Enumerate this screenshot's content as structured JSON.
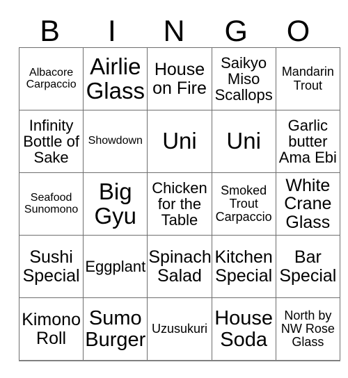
{
  "card": {
    "headers": [
      "B",
      "I",
      "N",
      "G",
      "O"
    ],
    "rows": [
      [
        {
          "text": "Albacore Carpaccio",
          "size": "xs"
        },
        {
          "text": "Airlie Glass",
          "size": "xxl"
        },
        {
          "text": "House on Fire",
          "size": "l"
        },
        {
          "text": "Saikyo Miso Scallops",
          "size": "m"
        },
        {
          "text": "Mandarin Trout",
          "size": "s"
        }
      ],
      [
        {
          "text": "Infinity Bottle of Sake",
          "size": "m"
        },
        {
          "text": "Showdown",
          "size": "xs"
        },
        {
          "text": "Uni",
          "size": "xxl"
        },
        {
          "text": "Uni",
          "size": "xxl"
        },
        {
          "text": "Garlic butter Ama Ebi",
          "size": "m"
        }
      ],
      [
        {
          "text": "Seafood Sunomono",
          "size": "xs"
        },
        {
          "text": "Big Gyu",
          "size": "xxl"
        },
        {
          "text": "Chicken for the Table",
          "size": "m"
        },
        {
          "text": "Smoked Trout Carpaccio",
          "size": "s"
        },
        {
          "text": "White Crane Glass",
          "size": "l"
        }
      ],
      [
        {
          "text": "Sushi Special",
          "size": "l"
        },
        {
          "text": "Eggplant",
          "size": "m"
        },
        {
          "text": "Spinach Salad",
          "size": "l"
        },
        {
          "text": "Kitchen Special",
          "size": "l"
        },
        {
          "text": "Bar Special",
          "size": "l"
        }
      ],
      [
        {
          "text": "Kimono Roll",
          "size": "l"
        },
        {
          "text": "Sumo Burger",
          "size": "xl"
        },
        {
          "text": "Uzusukuri",
          "size": "s"
        },
        {
          "text": "House Soda",
          "size": "xl"
        },
        {
          "text": "North by NW Rose Glass",
          "size": "s"
        }
      ]
    ]
  },
  "colors": {
    "background": "#ffffff",
    "text": "#000000",
    "grid_line": "#6e6e6e",
    "outer_border": "#1a1a1a"
  }
}
